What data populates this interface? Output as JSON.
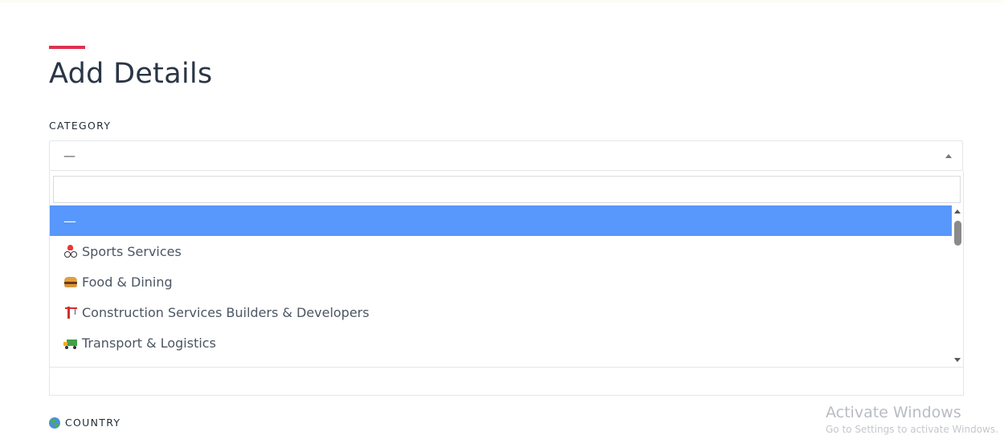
{
  "page": {
    "title": "Add Details",
    "accent_color": "#dc3250"
  },
  "category": {
    "label": "CATEGORY",
    "selected_value": "—",
    "dropdown": {
      "search_value": "",
      "highlight_color": "#5897fb",
      "options": [
        {
          "label": "—",
          "icon": "",
          "highlighted": true
        },
        {
          "label": "Sports Services",
          "icon": "bicycle-icon",
          "highlighted": false
        },
        {
          "label": "Food & Dining",
          "icon": "burger-icon",
          "highlighted": false
        },
        {
          "label": "Construction Services Builders & Developers",
          "icon": "crane-icon",
          "highlighted": false
        },
        {
          "label": "Transport & Logistics",
          "icon": "truck-icon",
          "highlighted": false
        }
      ]
    }
  },
  "country": {
    "label": "COUNTRY",
    "icon": "globe-icon"
  },
  "watermark": {
    "title": "Activate Windows",
    "subtitle": "Go to Settings to activate Windows."
  }
}
